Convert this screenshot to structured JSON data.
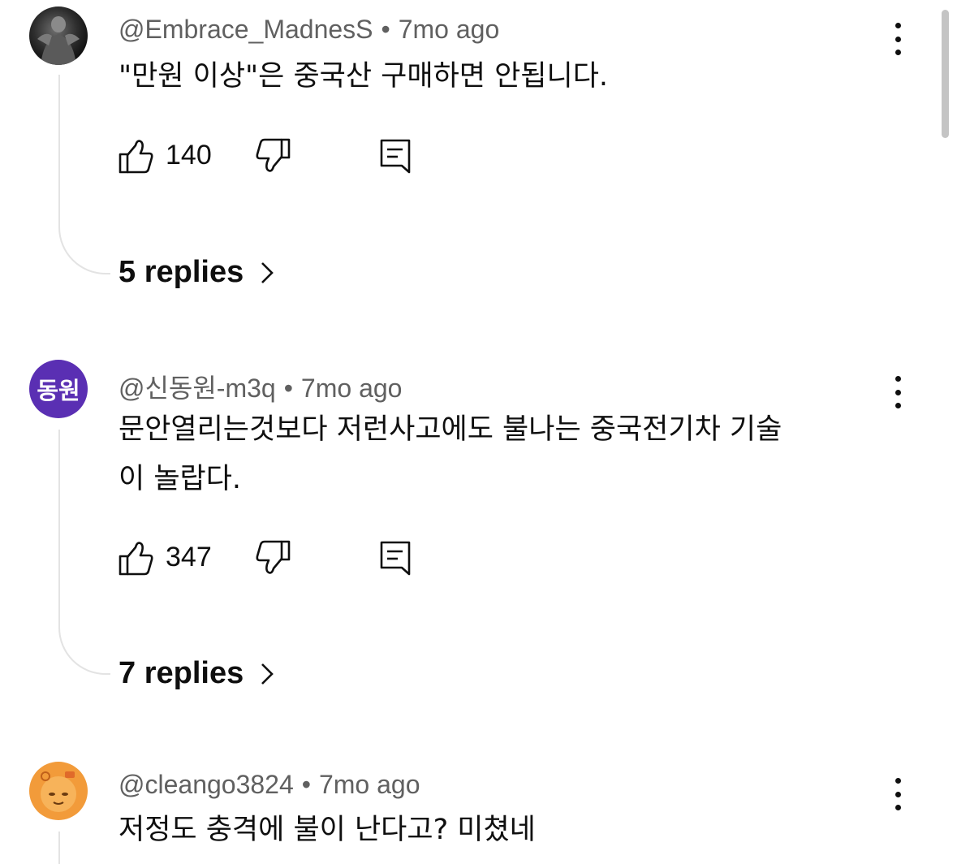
{
  "comments": [
    {
      "author": "@Embrace_MadnesS",
      "separator": "•",
      "time": "7mo ago",
      "text_lines": [
        "\"만원 이상\"은 중국산 구매하면 안됩니다."
      ],
      "likes": "140",
      "replies": "5 replies"
    },
    {
      "author": "@신동원-m3q",
      "avatar_text": "동원",
      "separator": "•",
      "time": "7mo ago",
      "text_lines": [
        "문안열리는것보다  저런사고에도 불나는 중국전기차 기술",
        "이  놀랍다."
      ],
      "likes": "347",
      "replies": "7 replies"
    },
    {
      "author": "@cleango3824",
      "separator": "•",
      "time": "7mo ago",
      "text_lines": [
        "저정도 충격에 불이 난다고? 미쳤네"
      ]
    }
  ],
  "icons": {
    "like": "thumbs-up-icon",
    "dislike": "thumbs-down-icon",
    "reply": "reply-icon",
    "more": "more-vert-icon",
    "chevron": "chevron-right-icon"
  },
  "colors": {
    "text": "#0f0f0f",
    "meta": "#606060",
    "avatar_purple": "#5a2fb3",
    "avatar_orange": "#f29b3a"
  }
}
